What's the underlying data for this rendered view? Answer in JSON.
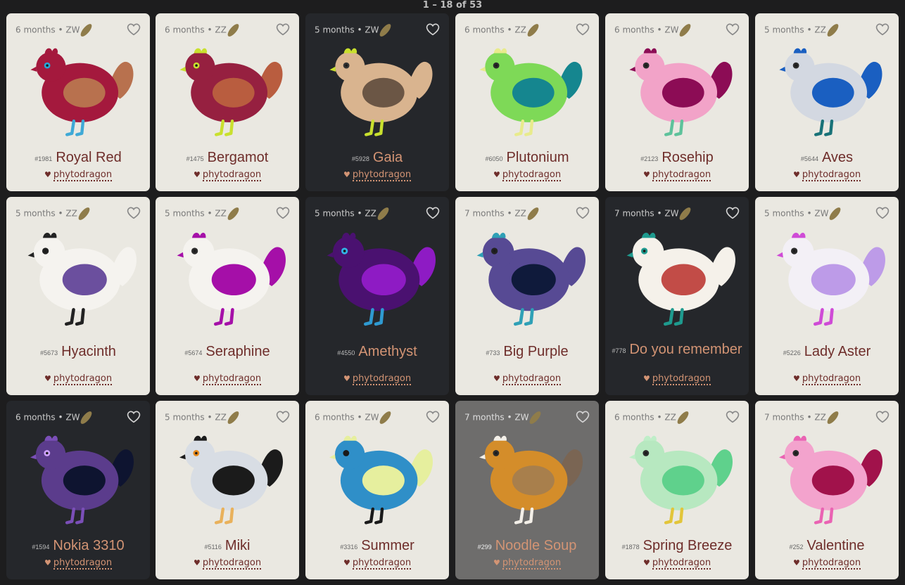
{
  "pagination": "1 – 18 of 53",
  "owner": "phytodragon",
  "icons": {
    "favorite": "heart-outline-icon",
    "owner": "heart-icon",
    "seed": "seed-icon"
  },
  "cards": [
    {
      "age": "6 months",
      "sex": "ZW",
      "id": "#1981",
      "name": "Royal Red",
      "bg": "light",
      "body": "#a4193d",
      "wing": "#b8714e",
      "tail": "#b8714e",
      "comb": "#a4193d",
      "leg": "#3fa9d6",
      "eye": "#27a7d8"
    },
    {
      "age": "6 months",
      "sex": "ZZ",
      "id": "#1475",
      "name": "Bergamot",
      "bg": "light",
      "body": "#962040",
      "wing": "#b95d3f",
      "tail": "#b95d3f",
      "comb": "#c9e02e",
      "leg": "#c9e02e",
      "eye": "#c9e02e"
    },
    {
      "age": "5 months",
      "sex": "ZW",
      "id": "#5928",
      "name": "Gaia",
      "bg": "dark",
      "body": "#d9b48f",
      "wing": "#6b5645",
      "tail": "#d9b48f",
      "comb": "#c9e02e",
      "leg": "#c9e02e",
      "eye": "#333333"
    },
    {
      "age": "6 months",
      "sex": "ZZ",
      "id": "#6050",
      "name": "Plutonium",
      "bg": "light",
      "body": "#7ed957",
      "wing": "#15868f",
      "tail": "#15868f",
      "comb": "#e8eb8c",
      "leg": "#e8eb8c",
      "eye": "#2b2b2b"
    },
    {
      "age": "6 months",
      "sex": "ZW",
      "id": "#2123",
      "name": "Rosehip",
      "bg": "light",
      "body": "#f2a3c8",
      "wing": "#8c0c55",
      "tail": "#8c0c55",
      "comb": "#8c0c55",
      "leg": "#5ec29b",
      "eye": "#2b2b2b"
    },
    {
      "age": "5 months",
      "sex": "ZZ",
      "id": "#5644",
      "name": "Aves",
      "bg": "light",
      "body": "#d3d8e1",
      "wing": "#1a5fc1",
      "tail": "#1a5fc1",
      "comb": "#1a5fc1",
      "leg": "#197278",
      "eye": "#2b2b2b"
    },
    {
      "age": "5 months",
      "sex": "ZZ",
      "id": "#5673",
      "name": "Hyacinth",
      "bg": "light",
      "body": "#f5f3ef",
      "wing": "#6b4f9e",
      "tail": "#f5f3ef",
      "comb": "#222222",
      "leg": "#222222",
      "eye": "#222222"
    },
    {
      "age": "5 months",
      "sex": "ZZ",
      "id": "#5674",
      "name": "Seraphine",
      "bg": "light",
      "body": "#f5f3ef",
      "wing": "#a50fa8",
      "tail": "#a50fa8",
      "comb": "#a50fa8",
      "leg": "#a50fa8",
      "eye": "#2b2b2b"
    },
    {
      "age": "5 months",
      "sex": "ZZ",
      "id": "#4550",
      "name": "Amethyst",
      "bg": "dark",
      "body": "#4a1170",
      "wing": "#8e1bc4",
      "tail": "#8e1bc4",
      "comb": "#4a1170",
      "leg": "#2f9ad1",
      "eye": "#32b4e6"
    },
    {
      "age": "7 months",
      "sex": "ZZ",
      "id": "#733",
      "name": "Big Purple",
      "bg": "light",
      "body": "#574a94",
      "wing": "#0f1a3b",
      "tail": "#574a94",
      "comb": "#2fa0b6",
      "leg": "#2fa0b6",
      "eye": "#222222"
    },
    {
      "age": "7 months",
      "sex": "ZW",
      "id": "#778",
      "name": "Do you remember",
      "bg": "dark",
      "body": "#f5f1ea",
      "wing": "#c24c47",
      "tail": "#f5f1ea",
      "comb": "#1e9a8e",
      "leg": "#1e9a8e",
      "eye": "#1e9a8e"
    },
    {
      "age": "5 months",
      "sex": "ZW",
      "id": "#5226",
      "name": "Lady Aster",
      "bg": "light",
      "body": "#f3f0f6",
      "wing": "#bd9be8",
      "tail": "#bd9be8",
      "comb": "#cf4bd6",
      "leg": "#cf4bd6",
      "eye": "#2b2b2b"
    },
    {
      "age": "6 months",
      "sex": "ZW",
      "id": "#1594",
      "name": "Nokia 3310",
      "bg": "dark",
      "body": "#5b3c8c",
      "wing": "#0e1430",
      "tail": "#0e1430",
      "comb": "#7b4fb8",
      "leg": "#7b4fb8",
      "eye": "#cfa3ff"
    },
    {
      "age": "5 months",
      "sex": "ZZ",
      "id": "#5116",
      "name": "Miki",
      "bg": "light",
      "body": "#d8dde4",
      "wing": "#1b1b1b",
      "tail": "#1b1b1b",
      "comb": "#1b1b1b",
      "leg": "#e9b15b",
      "eye": "#e98b1c"
    },
    {
      "age": "6 months",
      "sex": "ZW",
      "id": "#3316",
      "name": "Summer",
      "bg": "light",
      "body": "#2f8fc8",
      "wing": "#e6ef9e",
      "tail": "#e6ef9e",
      "comb": "#e6ef9e",
      "leg": "#1a1a1a",
      "eye": "#1a1a1a"
    },
    {
      "age": "7 months",
      "sex": "ZW",
      "id": "#299",
      "name": "Noodle Soup",
      "bg": "photo",
      "body": "#d48d2a",
      "wing": "#a87f4c",
      "tail": "#7a6553",
      "comb": "#f3efe8",
      "leg": "#f3efe8",
      "eye": "#2b2b2b"
    },
    {
      "age": "6 months",
      "sex": "ZZ",
      "id": "#1878",
      "name": "Spring Breeze",
      "bg": "light",
      "body": "#b7e8c0",
      "wing": "#5fd18c",
      "tail": "#5fd18c",
      "comb": "#bfeec8",
      "leg": "#e2c53a",
      "eye": "#2b2b2b"
    },
    {
      "age": "7 months",
      "sex": "ZZ",
      "id": "#252",
      "name": "Valentine",
      "bg": "light",
      "body": "#f3a3cd",
      "wing": "#a1124b",
      "tail": "#a1124b",
      "comb": "#ea63b3",
      "leg": "#ea63b3",
      "eye": "#2b2b2b"
    }
  ]
}
